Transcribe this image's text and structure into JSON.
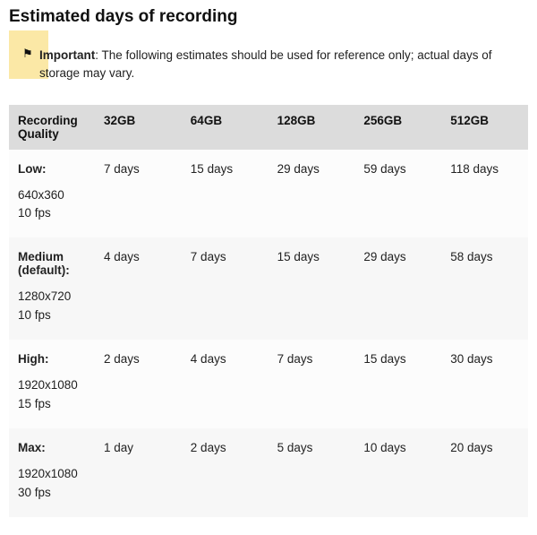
{
  "title": "Estimated days of recording",
  "callout": {
    "icon_glyph": "⚑",
    "label": "Important",
    "text": ": The following estimates should be used for reference only; actual days of storage may vary."
  },
  "table": {
    "headers": [
      "Recording Quality",
      "32GB",
      "64GB",
      "128GB",
      "256GB",
      "512GB"
    ],
    "rows": [
      {
        "quality_name": "Low:",
        "quality_res": "640x360",
        "quality_fps": "10 fps",
        "values": [
          "7 days",
          "15 days",
          "29 days",
          "59 days",
          "118 days"
        ]
      },
      {
        "quality_name": "Medium (default):",
        "quality_res": "1280x720",
        "quality_fps": "10 fps",
        "values": [
          "4 days",
          "7 days",
          "15 days",
          "29 days",
          "58 days"
        ]
      },
      {
        "quality_name": "High:",
        "quality_res": "1920x1080",
        "quality_fps": "15 fps",
        "values": [
          "2 days",
          "4 days",
          "7 days",
          "15 days",
          "30 days"
        ]
      },
      {
        "quality_name": "Max:",
        "quality_res": "1920x1080",
        "quality_fps": "30 fps",
        "values": [
          "1 day",
          "2 days",
          "5 days",
          "10 days",
          "20 days"
        ]
      }
    ]
  }
}
